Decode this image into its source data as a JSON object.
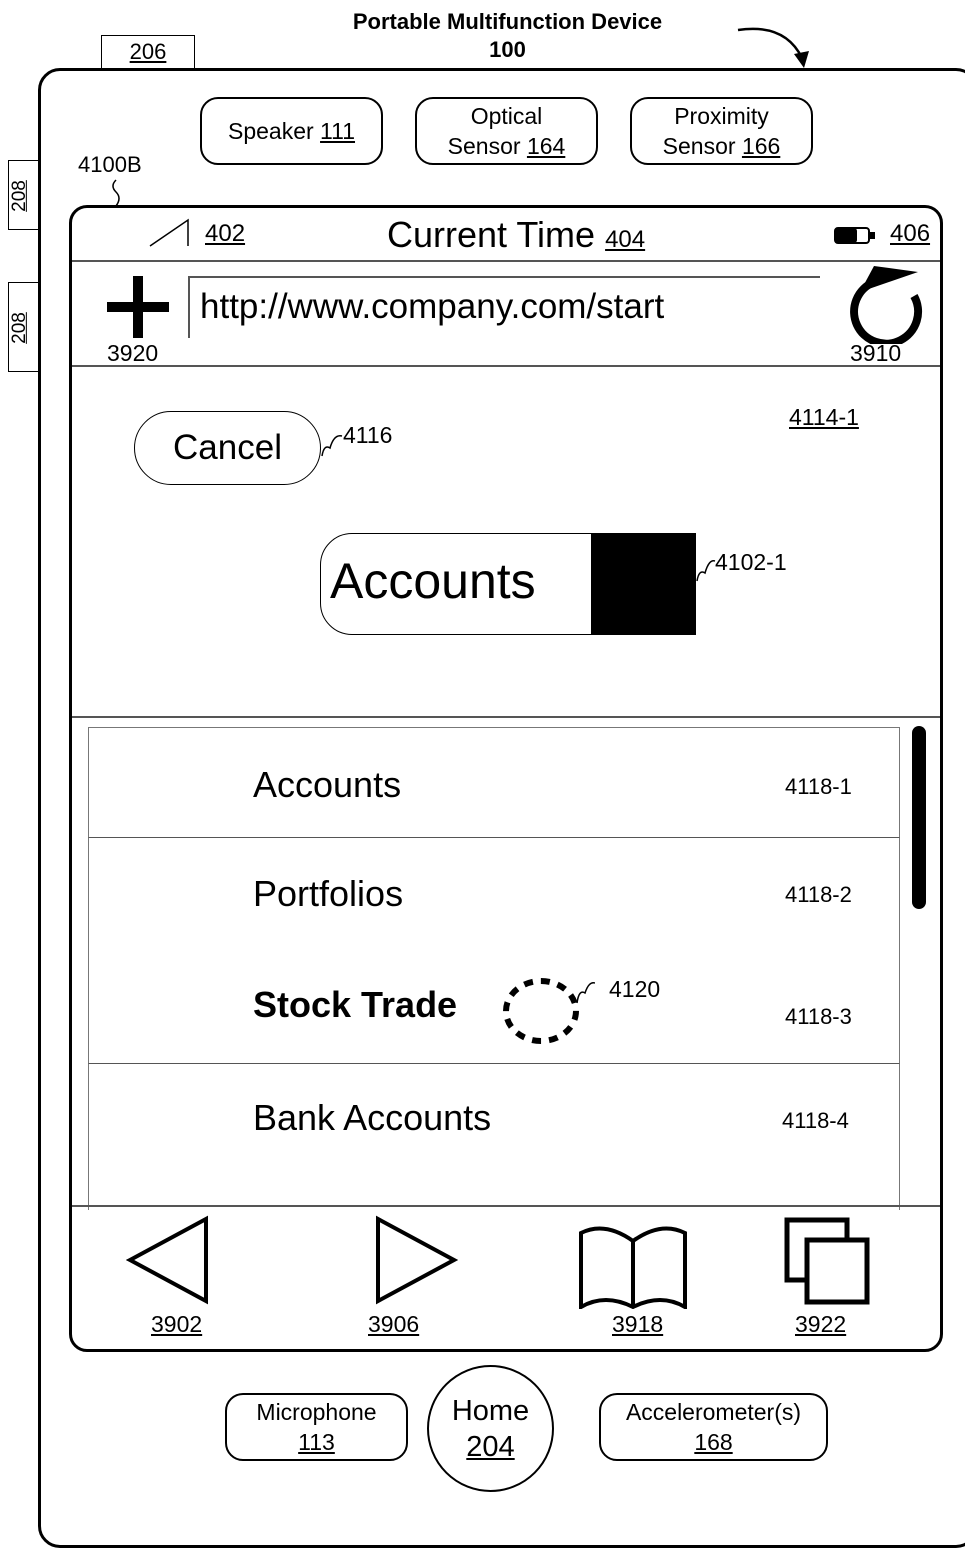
{
  "header": {
    "title_line1": "Portable Multifunction Device",
    "title_line2": "100",
    "ref_206": "206",
    "ref_208_a": "208",
    "ref_208_b": "208",
    "ref_4100B": "4100B"
  },
  "sensors": {
    "speaker_label": "Speaker",
    "speaker_ref": "111",
    "optical_line1": "Optical",
    "optical_line2": "Sensor",
    "optical_ref": "164",
    "proximity_line1": "Proximity",
    "proximity_line2": "Sensor",
    "proximity_ref": "166"
  },
  "status_bar": {
    "signal_ref": "402",
    "time_label": "Current Time",
    "time_ref": "404",
    "battery_ref": "406"
  },
  "url_bar": {
    "add_ref": "3920",
    "url": "http://www.company.com/start",
    "refresh_ref": "3910"
  },
  "form": {
    "panel_ref": "4114-1",
    "cancel_label": "Cancel",
    "cancel_ref": "4116",
    "field_value": "Accounts",
    "field_ref": "4102-1"
  },
  "list": {
    "items": [
      {
        "label": "Accounts",
        "ref": "4118-1"
      },
      {
        "label": "Portfolios",
        "ref": "4118-2"
      },
      {
        "label": "Stock Trade",
        "ref": "4118-3"
      },
      {
        "label": "Bank Accounts",
        "ref": "4118-4"
      }
    ],
    "contact_ref": "4120"
  },
  "toolbar": {
    "back_ref": "3902",
    "forward_ref": "3906",
    "bookmarks_ref": "3918",
    "pages_ref": "3922"
  },
  "bottom": {
    "microphone_label": "Microphone",
    "microphone_ref": "113",
    "home_label": "Home",
    "home_ref": "204",
    "accel_label": "Accelerometer(s)",
    "accel_ref": "168"
  },
  "icons": [
    "arrow-icon",
    "signal-icon",
    "battery-icon",
    "plus-icon",
    "refresh-icon",
    "back-icon",
    "forward-icon",
    "book-icon",
    "pages-icon"
  ]
}
